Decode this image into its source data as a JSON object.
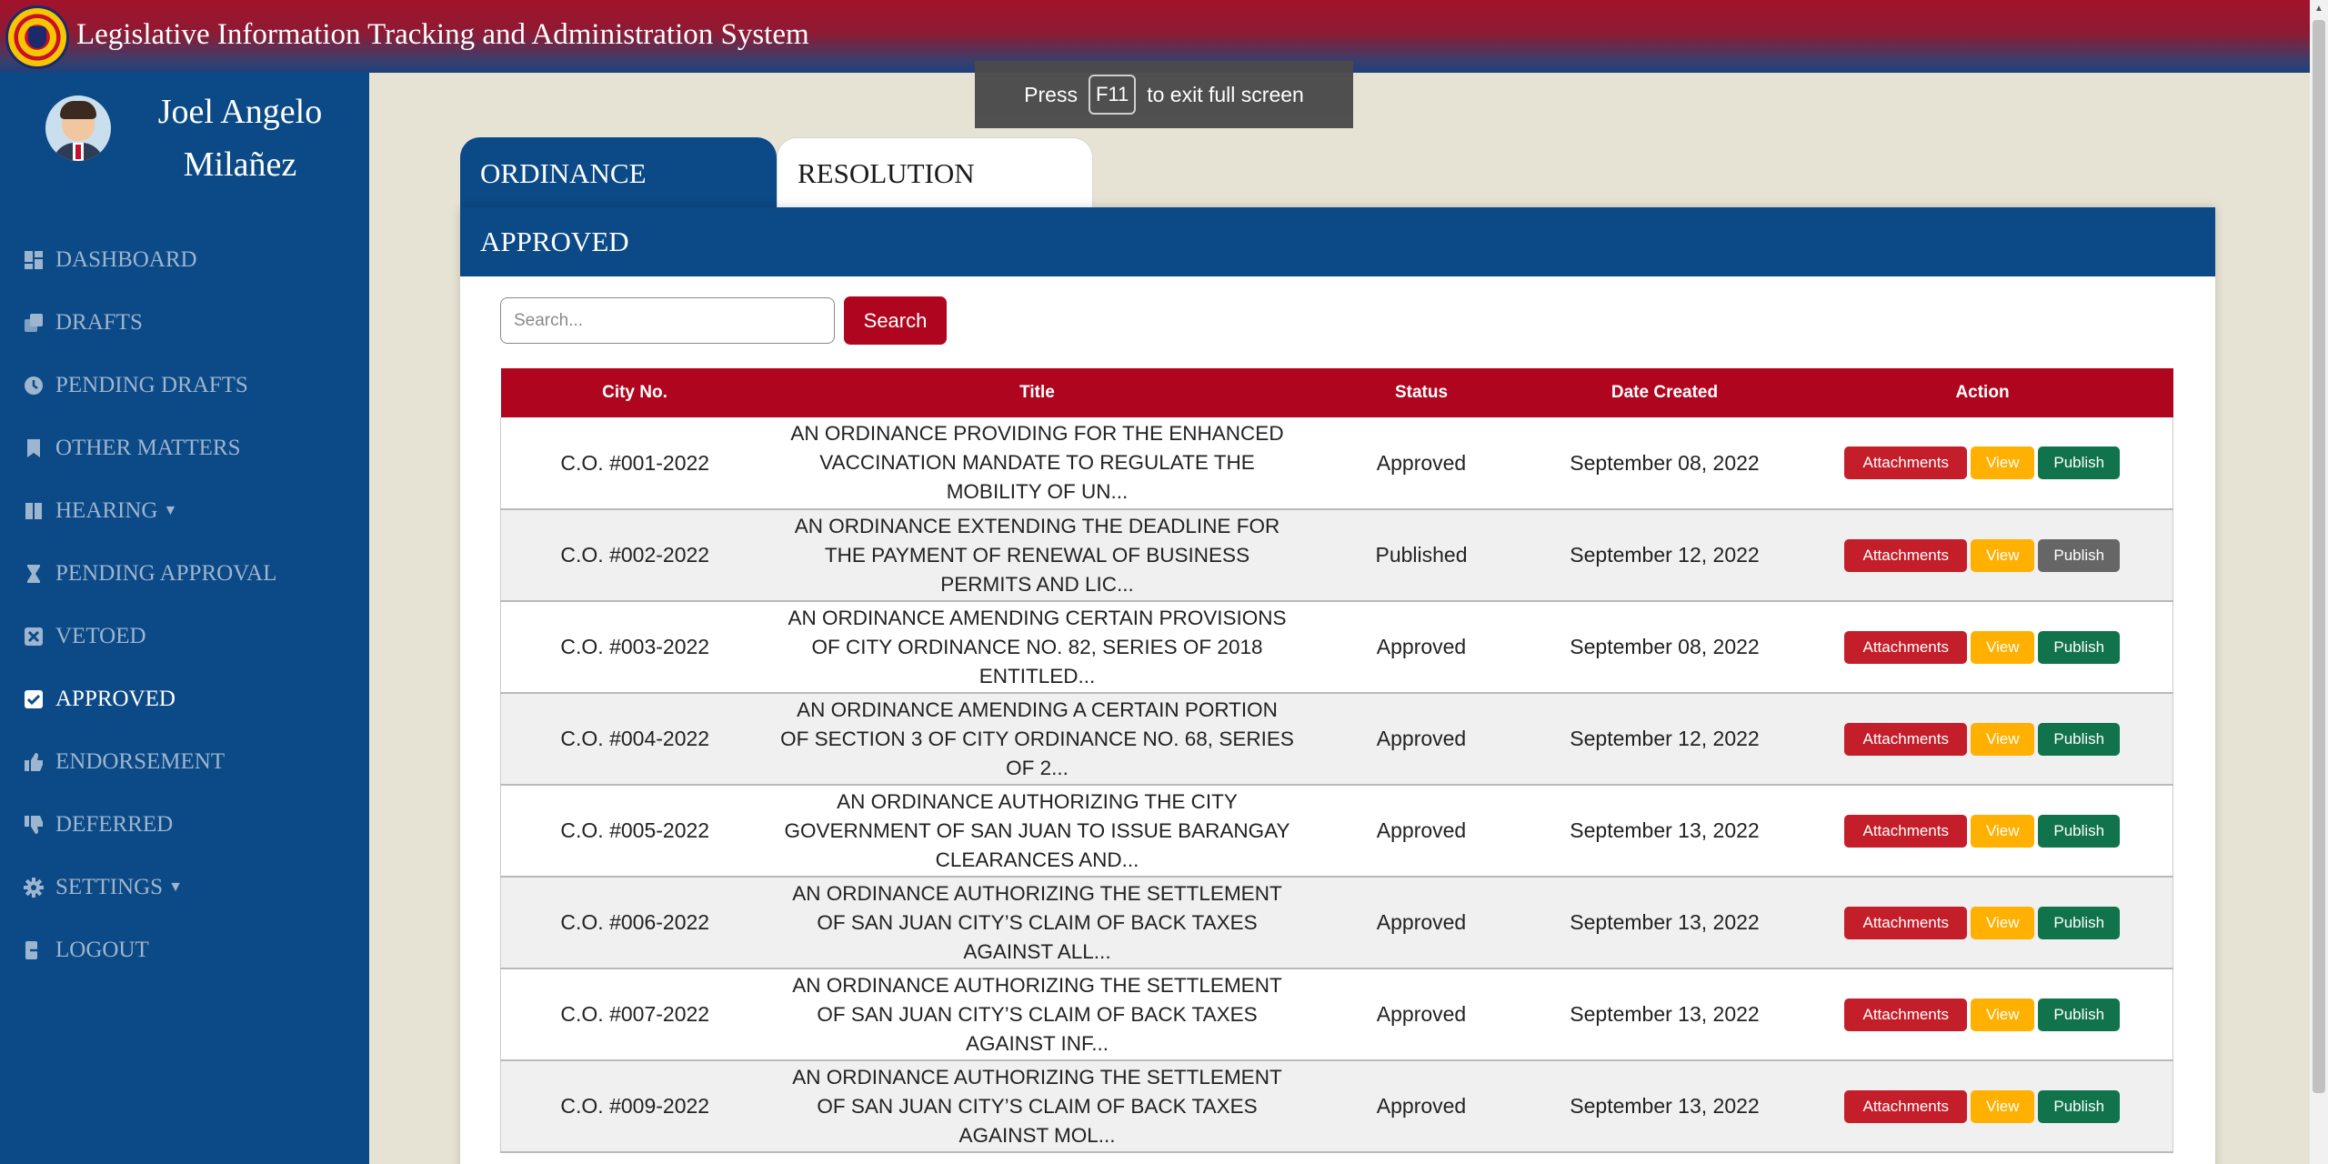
{
  "app": {
    "title": "Legislative Information Tracking and Administration System"
  },
  "user": {
    "name": "Joel Angelo Milañez"
  },
  "sidebar": {
    "items": [
      {
        "label": "DASHBOARD",
        "icon": "dashboard-icon"
      },
      {
        "label": "DRAFTS",
        "icon": "copy-icon"
      },
      {
        "label": "PENDING DRAFTS",
        "icon": "clock-icon"
      },
      {
        "label": "OTHER MATTERS",
        "icon": "bookmark-icon"
      },
      {
        "label": "HEARING",
        "icon": "book-icon",
        "has_caret": true
      },
      {
        "label": "PENDING APPROVAL",
        "icon": "hourglass-icon"
      },
      {
        "label": "VETOED",
        "icon": "x-square-icon"
      },
      {
        "label": "APPROVED",
        "icon": "check-square-icon",
        "active": true
      },
      {
        "label": "ENDORSEMENT",
        "icon": "thumbs-up-icon"
      },
      {
        "label": "DEFERRED",
        "icon": "thumbs-down-icon"
      },
      {
        "label": "SETTINGS",
        "icon": "gear-icon",
        "has_caret": true
      },
      {
        "label": "LOGOUT",
        "icon": "logout-icon"
      }
    ]
  },
  "fullscreen_notice": {
    "press": "Press",
    "key": "F11",
    "rest": "to exit full screen"
  },
  "tabs": [
    {
      "label": "ORDINANCE",
      "active": true
    },
    {
      "label": "RESOLUTION"
    }
  ],
  "panel": {
    "title": "APPROVED"
  },
  "search": {
    "placeholder": "Search...",
    "button_label": "Search"
  },
  "table": {
    "headers": [
      "City No.",
      "Title",
      "Status",
      "Date Created",
      "Action"
    ],
    "action_labels": {
      "attachments": "Attachments",
      "view": "View",
      "publish": "Publish"
    },
    "rows": [
      {
        "city_no": "C.O. #001-2022",
        "title": "AN ORDINANCE PROVIDING FOR THE ENHANCED VACCINATION MANDATE TO REGULATE THE MOBILITY OF UN...",
        "status": "Approved",
        "date": "September 08, 2022",
        "publish_disabled": false
      },
      {
        "city_no": "C.O. #002-2022",
        "title": "AN ORDINANCE EXTENDING THE DEADLINE FOR THE PAYMENT OF RENEWAL OF BUSINESS PERMITS AND LIC...",
        "status": "Published",
        "date": "September 12, 2022",
        "publish_disabled": true
      },
      {
        "city_no": "C.O. #003-2022",
        "title": "AN ORDINANCE AMENDING CERTAIN PROVISIONS OF CITY ORDINANCE NO. 82, SERIES OF 2018 ENTITLED...",
        "status": "Approved",
        "date": "September 08, 2022",
        "publish_disabled": false
      },
      {
        "city_no": "C.O. #004-2022",
        "title": "AN ORDINANCE AMENDING A CERTAIN PORTION OF SECTION 3 OF CITY ORDINANCE NO. 68, SERIES OF 2...",
        "status": "Approved",
        "date": "September 12, 2022",
        "publish_disabled": false
      },
      {
        "city_no": "C.O. #005-2022",
        "title": "AN ORDINANCE AUTHORIZING THE CITY GOVERNMENT OF SAN JUAN TO ISSUE BARANGAY CLEARANCES AND...",
        "status": "Approved",
        "date": "September 13, 2022",
        "publish_disabled": false
      },
      {
        "city_no": "C.O. #006-2022",
        "title": "AN ORDINANCE AUTHORIZING THE SETTLEMENT OF SAN JUAN CITY’S CLAIM OF BACK TAXES AGAINST ALL...",
        "status": "Approved",
        "date": "September 13, 2022",
        "publish_disabled": false
      },
      {
        "city_no": "C.O. #007-2022",
        "title": "AN ORDINANCE AUTHORIZING THE SETTLEMENT OF SAN JUAN CITY’S CLAIM OF BACK TAXES AGAINST INF...",
        "status": "Approved",
        "date": "September 13, 2022",
        "publish_disabled": false
      },
      {
        "city_no": "C.O. #009-2022",
        "title": "AN ORDINANCE AUTHORIZING THE SETTLEMENT OF SAN JUAN CITY’S CLAIM OF BACK TAXES AGAINST MOL...",
        "status": "Approved",
        "date": "September 13, 2022",
        "publish_disabled": false
      }
    ]
  }
}
